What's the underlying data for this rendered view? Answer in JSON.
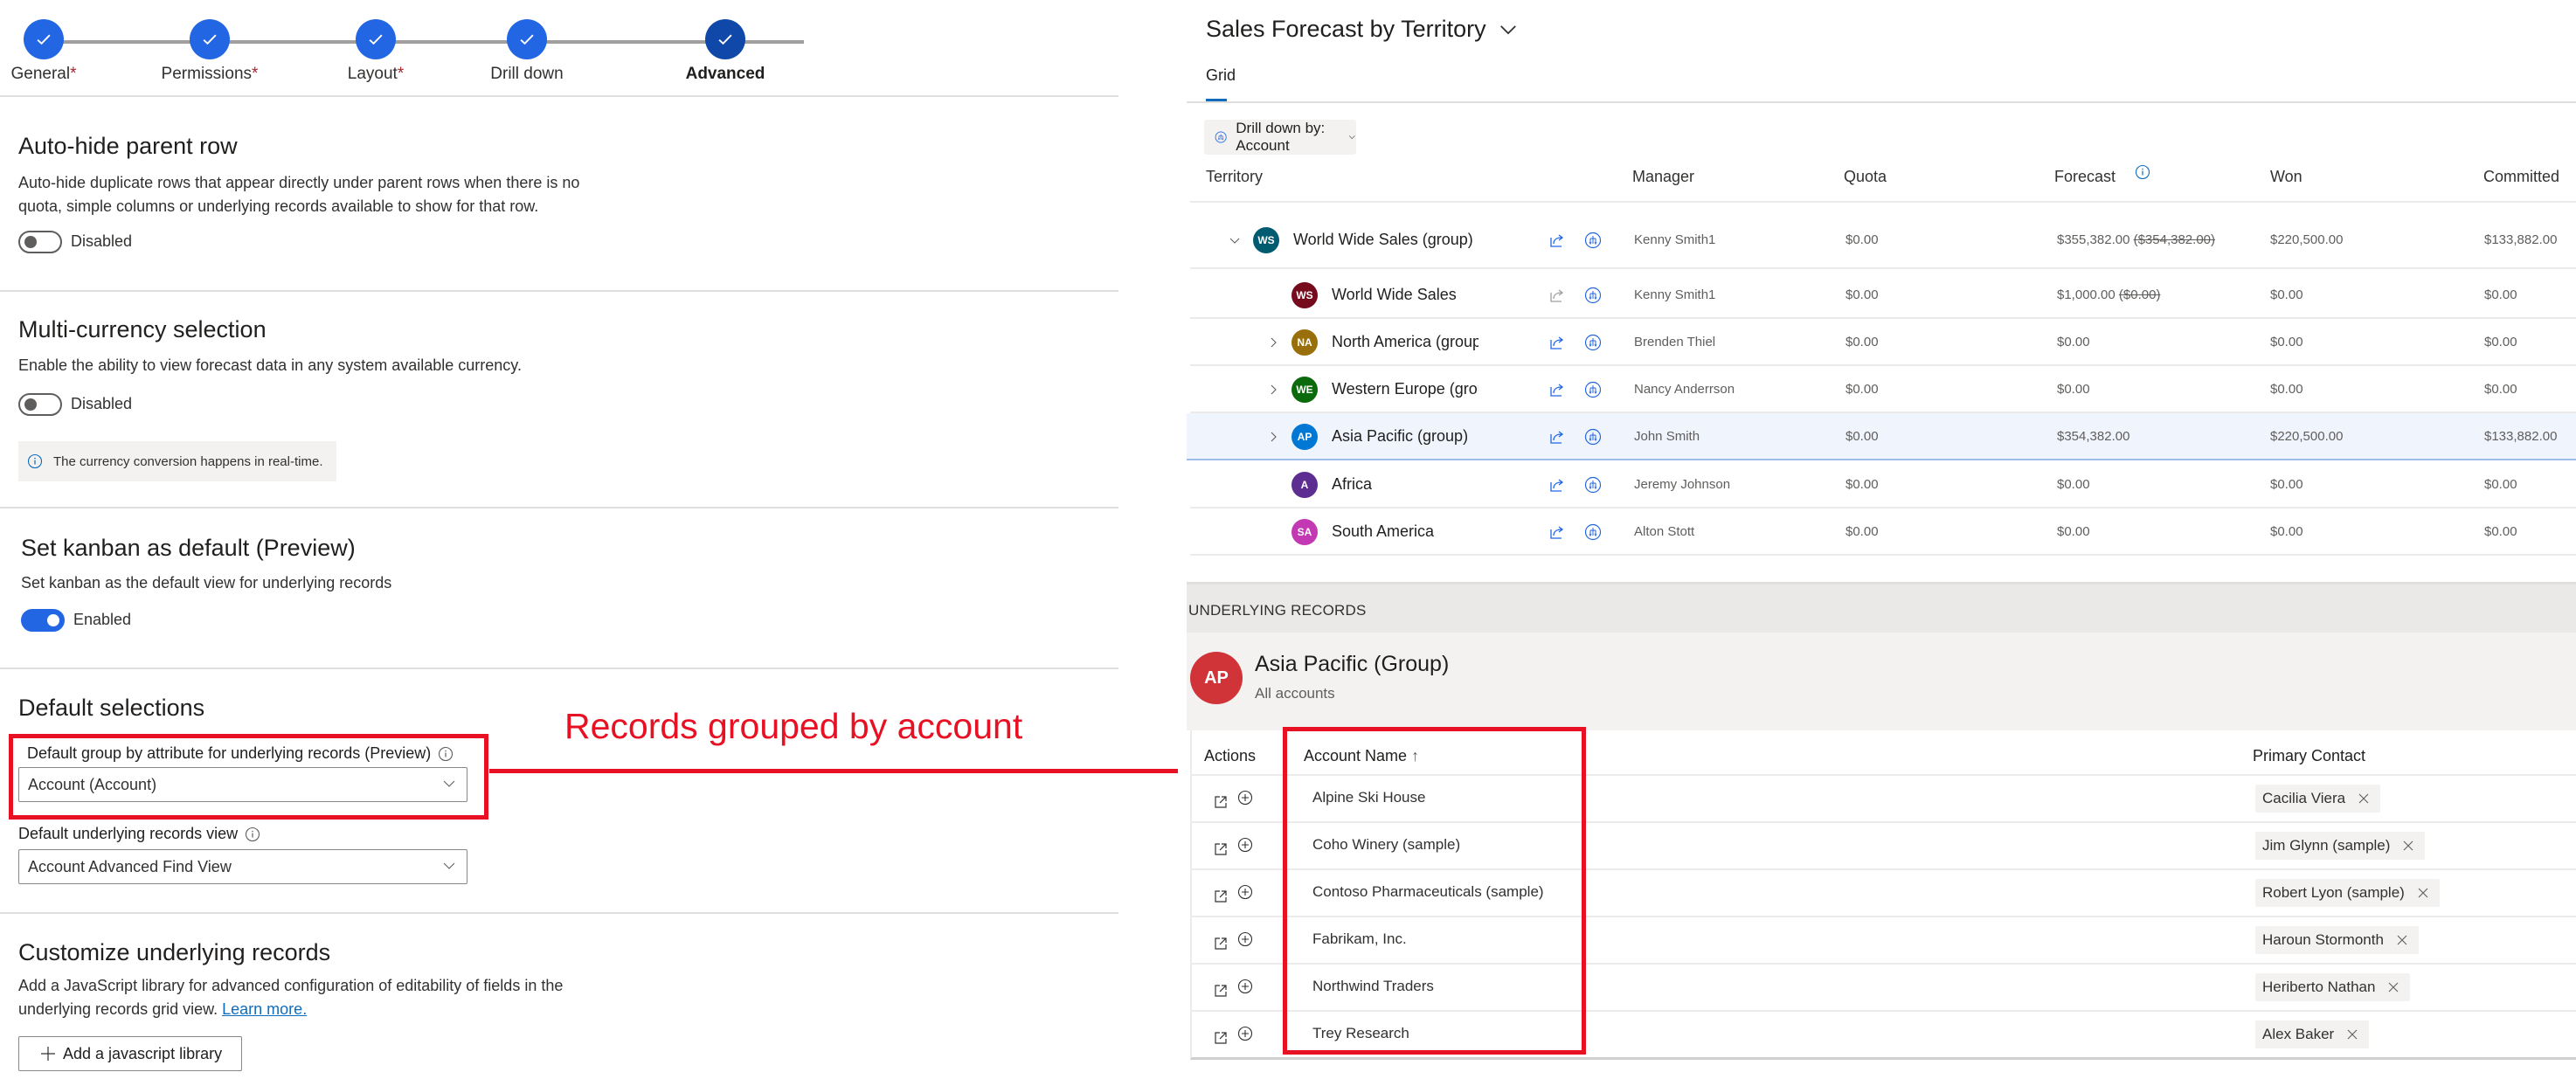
{
  "stepper": {
    "steps": [
      {
        "label": "General",
        "required": true,
        "state": "completed"
      },
      {
        "label": "Permissions",
        "required": true,
        "state": "completed"
      },
      {
        "label": "Layout",
        "required": true,
        "state": "completed"
      },
      {
        "label": "Drill down",
        "required": false,
        "state": "completed"
      },
      {
        "label": "Advanced",
        "required": false,
        "state": "current"
      }
    ],
    "required_marker": "*"
  },
  "settings": {
    "auto_hide": {
      "title": "Auto-hide parent row",
      "description": "Auto-hide duplicate rows that appear directly under parent rows when there is no quota, simple columns or underlying records available to show for that row.",
      "toggle_state": "Disabled",
      "enabled": false
    },
    "multi_currency": {
      "title": "Multi-currency selection",
      "description": "Enable the ability to view forecast data in any system available currency.",
      "toggle_state": "Disabled",
      "enabled": false,
      "info_message": "The currency conversion happens in real-time."
    },
    "kanban": {
      "title": "Set kanban as default (Preview)",
      "description": "Set kanban as the default view for underlying records",
      "toggle_state": "Enabled",
      "enabled": true
    },
    "default_selections": {
      "title": "Default selections",
      "group_by_label": "Default group by attribute for underlying records (Preview)",
      "group_by_value": "Account (Account)",
      "view_label": "Default underlying records view",
      "view_value": "Account Advanced Find View"
    },
    "customize": {
      "title": "Customize underlying records",
      "description": "Add a JavaScript library for advanced configuration of editability of fields in the underlying records grid view.",
      "learn_more": "Learn more.",
      "add_button": "Add a javascript library"
    }
  },
  "annotation": {
    "text": "Records grouped by account",
    "color": "#e81123"
  },
  "forecast": {
    "title": "Sales Forecast by Territory",
    "tabs": [
      {
        "label": "Grid",
        "active": true
      }
    ],
    "drill_down": "Drill down by: Account",
    "columns": {
      "territory": "Territory",
      "manager": "Manager",
      "quota": "Quota",
      "forecast": "Forecast",
      "won": "Won",
      "committed": "Committed"
    },
    "rows": [
      {
        "initials": "WS",
        "avatar_color": "#005b70",
        "name": "World Wide Sales (group)",
        "expander": "expanded",
        "level": 0,
        "bold": true,
        "manager": "Kenny Smith1",
        "quota": "$0.00",
        "forecast": "$355,382.00",
        "forecast_prev": "($354,382.00)",
        "won": "$220,500.00",
        "committed": "$133,882.00",
        "share_enabled": true,
        "selected": false
      },
      {
        "initials": "WS",
        "avatar_color": "#750b1c",
        "name": "World Wide Sales",
        "expander": "none",
        "level": 1,
        "bold": false,
        "manager": "Kenny Smith1",
        "quota": "$0.00",
        "forecast": "$1,000.00",
        "forecast_prev": "($0.00)",
        "won": "$0.00",
        "committed": "$0.00",
        "share_enabled": false,
        "selected": false
      },
      {
        "initials": "NA",
        "avatar_color": "#986f0b",
        "name": "North America (group)",
        "expander": "collapsed",
        "level": 1,
        "bold": false,
        "manager": "Brenden Thiel",
        "quota": "$0.00",
        "forecast": "$0.00",
        "forecast_prev": "",
        "won": "$0.00",
        "committed": "$0.00",
        "share_enabled": true,
        "selected": false
      },
      {
        "initials": "WE",
        "avatar_color": "#0b6a0b",
        "name": "Western Europe (group)",
        "expander": "collapsed",
        "level": 1,
        "bold": false,
        "manager": "Nancy Anderrson",
        "quota": "$0.00",
        "forecast": "$0.00",
        "forecast_prev": "",
        "won": "$0.00",
        "committed": "$0.00",
        "share_enabled": true,
        "selected": false
      },
      {
        "initials": "AP",
        "avatar_color": "#0078d4",
        "name": "Asia Pacific (group)",
        "expander": "collapsed",
        "level": 1,
        "bold": false,
        "manager": "John Smith",
        "quota": "$0.00",
        "forecast": "$354,382.00",
        "forecast_prev": "",
        "won": "$220,500.00",
        "committed": "$133,882.00",
        "share_enabled": true,
        "selected": true
      },
      {
        "initials": "A",
        "avatar_color": "#5c2e91",
        "name": "Africa",
        "expander": "none",
        "level": 1,
        "bold": false,
        "manager": "Jeremy Johnson",
        "quota": "$0.00",
        "forecast": "$0.00",
        "forecast_prev": "",
        "won": "$0.00",
        "committed": "$0.00",
        "share_enabled": true,
        "selected": false
      },
      {
        "initials": "SA",
        "avatar_color": "#c239b3",
        "name": "South America",
        "expander": "none",
        "level": 1,
        "bold": false,
        "manager": "Alton Stott",
        "quota": "$0.00",
        "forecast": "$0.00",
        "forecast_prev": "",
        "won": "$0.00",
        "committed": "$0.00",
        "share_enabled": true,
        "selected": false
      }
    ]
  },
  "underlying": {
    "section_label": "UNDERLYING RECORDS",
    "group_initials": "AP",
    "group_title": "Asia Pacific (Group)",
    "group_subtitle": "All accounts",
    "columns": {
      "actions": "Actions",
      "account_name": "Account Name",
      "sort_indicator": "↑",
      "primary_contact": "Primary Contact"
    },
    "records": [
      {
        "account": "Alpine Ski House",
        "contact": "Cacilia Viera"
      },
      {
        "account": "Coho Winery (sample)",
        "contact": "Jim Glynn (sample)"
      },
      {
        "account": "Contoso Pharmaceuticals (sample)",
        "contact": "Robert Lyon (sample)"
      },
      {
        "account": "Fabrikam, Inc.",
        "contact": "Haroun Stormonth"
      },
      {
        "account": "Northwind Traders",
        "contact": "Heriberto Nathan"
      },
      {
        "account": "Trey Research",
        "contact": "Alex Baker"
      }
    ]
  }
}
